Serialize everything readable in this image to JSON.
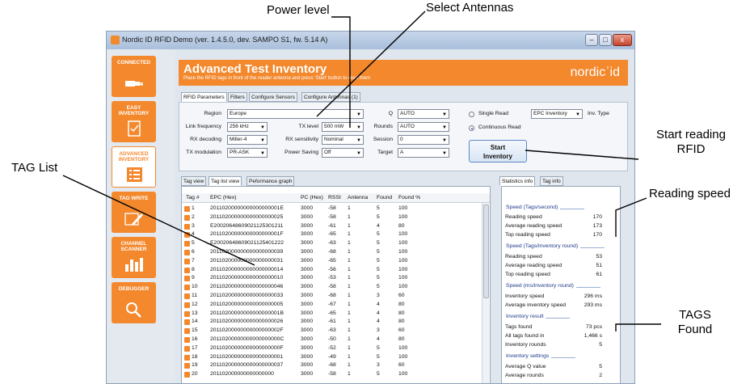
{
  "annotations": {
    "power_level": "Power level",
    "select_antennas": "Select Antennas",
    "start_reading": [
      "Start reading",
      "RFID"
    ],
    "tag_list": "TAG List",
    "reading_speed": "Reading speed",
    "tags_found": [
      "TAGS",
      "Found"
    ]
  },
  "window": {
    "title": "Nordic ID RFID Demo (ver. 1.4.5.0, dev. SAMPO S1, fw. 5.14 A)",
    "min": "–",
    "max": "□",
    "close": "x"
  },
  "nav": {
    "connected": "CONNECTED",
    "easy_inventory": [
      "EASY",
      "INVENTORY"
    ],
    "advanced_inventory": [
      "ADVANCED",
      "INVENTORY"
    ],
    "tag_write": "TAG WRITE",
    "channel_scanner": [
      "CHANNEL",
      "SCANNER"
    ],
    "debugger": "DEBUGGER"
  },
  "banner": {
    "title": "Advanced Test Inventory",
    "subtitle": "Place the RFID tags in front of the reader antenna and press 'Start' button to read them",
    "logo": "nordicʾid"
  },
  "params_tabs": [
    "RFID Parameters",
    "Filters",
    "Configure Sensors",
    "Configure Antennas (1)"
  ],
  "params": {
    "region_label": "Region",
    "region": "Europe",
    "link_frequency_label": "Link frequency",
    "link_frequency": "256 kHz",
    "tx_level_label": "TX level",
    "tx_level": "500 mW",
    "rx_decoding_label": "RX decoding",
    "rx_decoding": "Miller-4",
    "rx_sensitivity_label": "RX sensitivity",
    "rx_sensitivity": "Nominal",
    "tx_modulation_label": "TX modulation",
    "tx_modulation": "PR-ASK",
    "power_saving_label": "Power Saving",
    "power_saving": "Off",
    "q_label": "Q",
    "q": "AUTO",
    "rounds_label": "Rounds",
    "rounds": "AUTO",
    "session_label": "Session",
    "session": "0",
    "target_label": "Target",
    "target": "A",
    "single_read": "Single Read",
    "continuous_read": "Continuous Read",
    "inventory_type": "EPC Inventory",
    "inventory_type_label": "Inv. Type",
    "start_button": [
      "Start",
      "Inventory"
    ]
  },
  "list_tabs": [
    "Tag view",
    "Tag list view",
    "Peformance graph"
  ],
  "table": {
    "columns": [
      "Tag #",
      "EPC (Hex)",
      "PC (Hex)",
      "RSSI",
      "Antenna",
      "Found",
      "Found %"
    ],
    "rows": [
      [
        "1",
        "20110200000000000000001E",
        "3000",
        "-58",
        "1",
        "5",
        "100"
      ],
      [
        "2",
        "201102000000000000000025",
        "3000",
        "-58",
        "1",
        "5",
        "100"
      ],
      [
        "3",
        "E2002064860902112530121​1",
        "3000",
        "-61",
        "1",
        "4",
        "80"
      ],
      [
        "4",
        "20110200000000000000001F",
        "3000",
        "-65",
        "1",
        "5",
        "100"
      ],
      [
        "5",
        "E20020648609021125401222",
        "3000",
        "-63",
        "1",
        "5",
        "100"
      ],
      [
        "6",
        "201102000000000000000039",
        "3000",
        "-68",
        "1",
        "5",
        "100"
      ],
      [
        "7",
        "201102000000000000000031",
        "3000",
        "-65",
        "1",
        "5",
        "100"
      ],
      [
        "8",
        "201102000000000000000014",
        "3000",
        "-56",
        "1",
        "5",
        "100"
      ],
      [
        "9",
        "201102000000000000000010",
        "3000",
        "-53",
        "1",
        "5",
        "100"
      ],
      [
        "10",
        "201102000000000000000046",
        "3000",
        "-58",
        "1",
        "5",
        "100"
      ],
      [
        "11",
        "201102000000000000000033",
        "3000",
        "-68",
        "1",
        "3",
        "60"
      ],
      [
        "12",
        "201102000000000000000005",
        "3000",
        "-67",
        "1",
        "4",
        "80"
      ],
      [
        "13",
        "20110200000000000000001B",
        "3000",
        "-65",
        "1",
        "4",
        "80"
      ],
      [
        "14",
        "201102000000000000000026",
        "3000",
        "-61",
        "1",
        "4",
        "80"
      ],
      [
        "15",
        "20110200000000000000002F",
        "3000",
        "-63",
        "1",
        "3",
        "60"
      ],
      [
        "16",
        "20110200000000000000000C",
        "3000",
        "-50",
        "1",
        "4",
        "80"
      ],
      [
        "17",
        "20110200000000000000000F",
        "3000",
        "-52",
        "1",
        "5",
        "100"
      ],
      [
        "18",
        "201102000000000000000001",
        "3000",
        "-49",
        "1",
        "5",
        "100"
      ],
      [
        "19",
        "201102000000000000000037",
        "3000",
        "-68",
        "1",
        "3",
        "60"
      ],
      [
        "20",
        "201102000000000000000",
        "3000",
        "-58",
        "1",
        "5",
        "100"
      ]
    ]
  },
  "stats_tabs": [
    "Statistics info",
    "Tag info"
  ],
  "stats": {
    "speed_tags_title": "Speed (Tags/second)",
    "speed_tags": [
      [
        "Reading speed",
        "170"
      ],
      [
        "Average reading speed",
        "173"
      ],
      [
        "Top reading speed",
        "170"
      ]
    ],
    "speed_round_title": "Speed (Tags/inventory round)",
    "speed_round": [
      [
        "Reading speed",
        "53"
      ],
      [
        "Average reading speed",
        "51"
      ],
      [
        "Top reading speed",
        "61"
      ]
    ],
    "speed_ms_title": "Speed (ms/inventory round)",
    "speed_ms": [
      [
        "Inventory speed",
        "296 ms"
      ],
      [
        "Average inventory speed",
        "293 ms"
      ]
    ],
    "inventory_result_title": "Inventory result",
    "inventory_result": [
      [
        "Tags found",
        "73 pcs"
      ],
      [
        "All tags found in",
        "1,466 s"
      ],
      [
        "Inventory rounds",
        "5"
      ]
    ],
    "inventory_settings_title": "Inventory settings",
    "inventory_settings": [
      [
        "Average Q value",
        "5"
      ],
      [
        "Average rounds",
        "2"
      ]
    ]
  },
  "colors": {
    "accent": "#f3882d",
    "section_title": "#1f3a8a"
  }
}
